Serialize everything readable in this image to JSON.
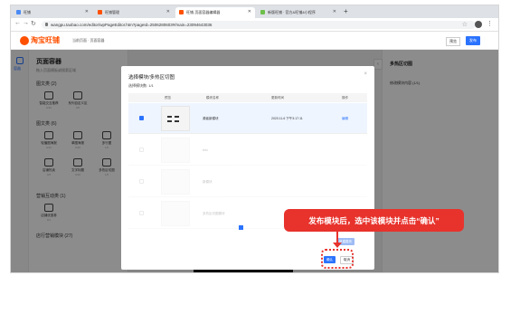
{
  "browser": {
    "tabs": [
      {
        "label": "旺铺",
        "fav_color": "#4a8af4",
        "active": false
      },
      {
        "label": "旺铺管理",
        "fav_color": "#ff5000",
        "active": false
      },
      {
        "label": "旺铺-页面容器编辑器",
        "fav_color": "#ff5000",
        "active": true
      },
      {
        "label": "新版旺铺 · 官方&旺铺&小程序",
        "fav_color": "#6cc04a",
        "active": false
      }
    ],
    "new_tab": "+",
    "url": "wangpu.taobao.com/editor/wpPageEditor.htm?pageId=2506280603#/main=23094643036"
  },
  "app": {
    "logo_text": "淘宝旺铺",
    "head_links": "当前页面 · 页面容器",
    "preview": "预览",
    "publish": "发布"
  },
  "rail": {
    "label": "容器"
  },
  "panel": {
    "title": "页面容器",
    "subtitle": "拖入页面模板或搜索区域",
    "categories": [
      {
        "name": "图文类 (2)",
        "items": [
          {
            "name": "智能交互推荐",
            "count": "0/30"
          },
          {
            "name": "系列自定义区",
            "count": "0/5"
          }
        ]
      },
      {
        "name": "图文类 (6)",
        "items": [
          {
            "name": "轮播图海报",
            "count": "0/10"
          },
          {
            "name": "单图海报",
            "count": "0/20"
          },
          {
            "name": "多行图",
            "count": "1/5"
          },
          {
            "name": "店铺热卖",
            "count": "0/3"
          },
          {
            "name": "文字标题",
            "count": "0/10"
          },
          {
            "name": "多热区切图",
            "count": "1/5"
          }
        ]
      },
      {
        "name": "营销互动类 (1)",
        "items": [
          {
            "name": "店铺优惠券",
            "count": "0/1"
          }
        ]
      },
      {
        "name": "店行营销模块 (27)",
        "items": []
      }
    ]
  },
  "right_panel": {
    "collapse": "‹",
    "title": "多热区切图",
    "subtitle": "修改模块内容 (1/1)"
  },
  "modal": {
    "title": "选择模块/多热区切图",
    "close": "×",
    "count": "选择模块数: 1/1",
    "columns": [
      "预览",
      "模块名称",
      "更新时间",
      "操作"
    ],
    "rows": [
      {
        "name": "源者新模块",
        "time": "2020.11.6 下午3:17:11",
        "action": "编辑",
        "selected": true
      },
      {
        "name": "test",
        "time": "",
        "action": "",
        "selected": false
      },
      {
        "name": "新模块",
        "time": "",
        "action": "",
        "selected": false
      },
      {
        "name": "多热区切图模块",
        "time": "",
        "action": "",
        "selected": false
      }
    ],
    "disabled_button": "新建模块",
    "confirm": "确认",
    "cancel": "取消"
  },
  "annotation": {
    "text": "发布模块后，选中该模块并点击“确认”",
    "color": "#e8322c"
  }
}
